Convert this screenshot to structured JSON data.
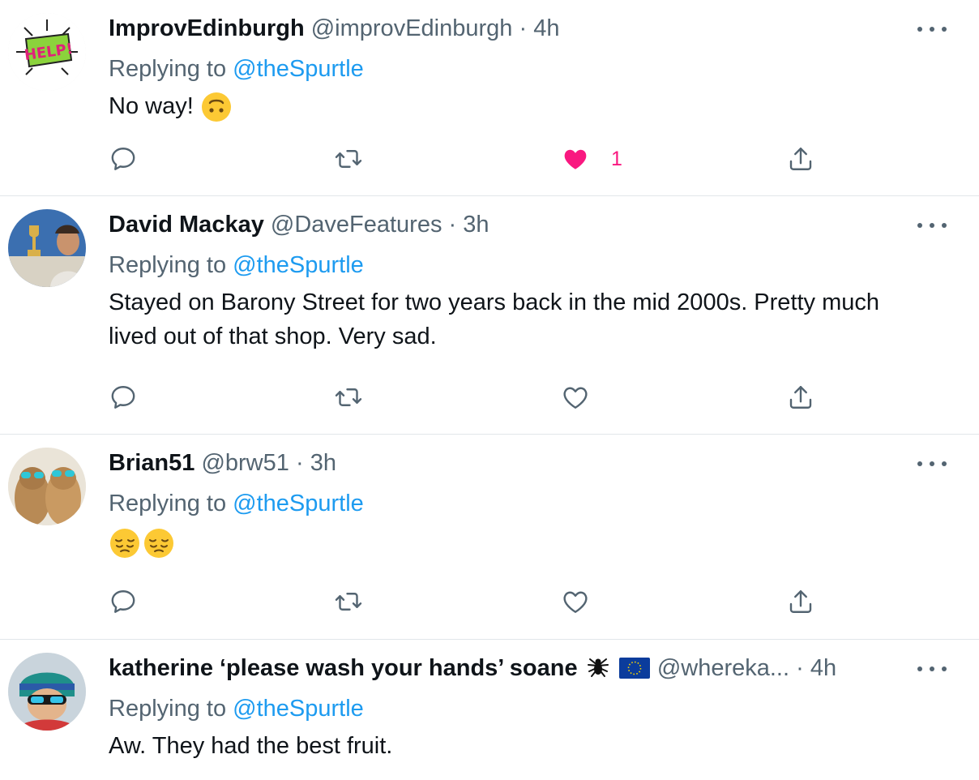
{
  "colors": {
    "link": "#1d9bf0",
    "muted": "#536471",
    "text": "#0f1419",
    "like_active": "#f91880",
    "divider": "#e1e6ea"
  },
  "icons": {
    "reply": "speech-bubble-icon",
    "retweet": "retweet-icon",
    "like": "heart-icon",
    "share": "share-icon",
    "more": "ellipsis-icon"
  },
  "tweets": [
    {
      "name": "ImprovEdinburgh",
      "handle": "@improvEdinburgh",
      "dot": "·",
      "time": "4h",
      "replying_prefix": "Replying to",
      "replying_to": "@theSpurtle",
      "text": "No way!",
      "emoji": [
        "upside-down-face"
      ],
      "liked": true,
      "like_count": "1"
    },
    {
      "name": "David Mackay",
      "handle": "@DaveFeatures",
      "dot": "·",
      "time": "3h",
      "replying_prefix": "Replying to",
      "replying_to": "@theSpurtle",
      "text": "Stayed on Barony Street for two years back in the mid 2000s. Pretty much lived out of that shop. Very sad.",
      "liked": false
    },
    {
      "name": "Brian51",
      "handle": "@brw51",
      "dot": "·",
      "time": "3h",
      "replying_prefix": "Replying to",
      "replying_to": "@theSpurtle",
      "text": "",
      "emoji": [
        "pensive-face",
        "pensive-face"
      ],
      "liked": false
    },
    {
      "name": "katherine ‘please wash your hands’ soane",
      "name_icons": [
        "spider-icon",
        "eu-flag-icon"
      ],
      "handle": "@whereka...",
      "dot": "·",
      "time": "4h",
      "replying_prefix": "Replying to",
      "replying_to": "@theSpurtle",
      "text": "Aw. They had the best fruit."
    }
  ]
}
